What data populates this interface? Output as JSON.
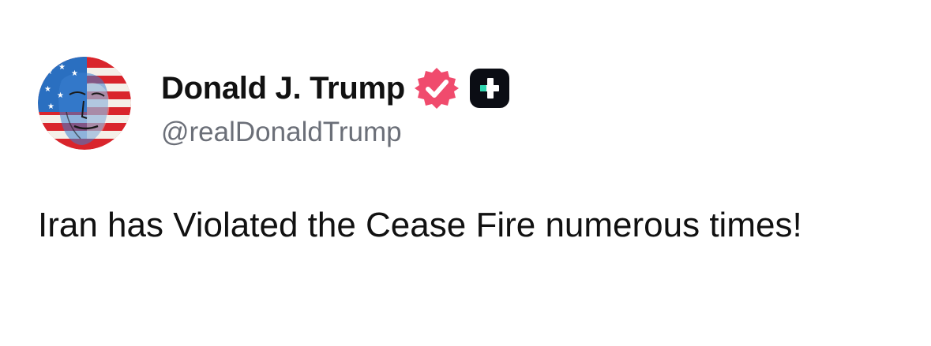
{
  "author": {
    "display_name": "Donald J. Trump",
    "handle": "@realDonaldTrump",
    "verified_icon": "verified-badge-icon",
    "plus_icon": "plus-badge-icon"
  },
  "post": {
    "text": "Iran has Violated the Cease Fire numerous times!"
  },
  "colors": {
    "verified": "#f04b6d",
    "plus_badge_bg": "#0b0d14",
    "plus_badge_accent": "#2fd6b0",
    "handle": "#6b6f78",
    "text": "#111111"
  }
}
